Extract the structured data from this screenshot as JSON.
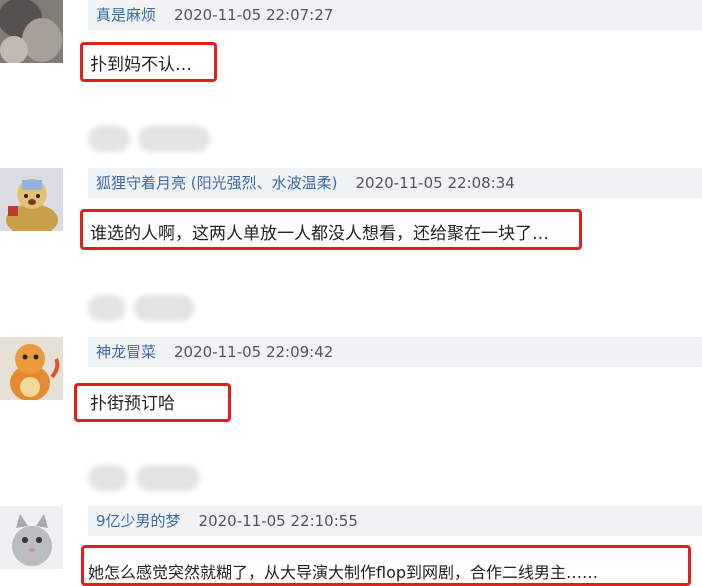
{
  "comments": [
    {
      "username": "真是麻烦",
      "note": "",
      "timestamp": "2020-11-05 22:07:27",
      "text": "扑到妈不认…",
      "avatar": "blurred-person-photo-avatar"
    },
    {
      "username": "狐狸守着月亮",
      "note": " (阳光强烈、水波温柔)",
      "timestamp": "2020-11-05 22:08:34",
      "text": "谁选的人啊，这两人单放一人都没人想看，还给聚在一块了…",
      "avatar": "cartoon-bear-avatar"
    },
    {
      "username": "神龙冒菜",
      "note": "",
      "timestamp": "2020-11-05 22:09:42",
      "text": "扑街预订哈",
      "avatar": "orange-dragon-avatar"
    },
    {
      "username": "9亿少男的梦",
      "note": "",
      "timestamp": "2020-11-05 22:10:55",
      "text": "她怎么感觉突然就糊了，从大导演大制作flop到网剧，合作二线男主……",
      "avatar": "kitten-avatar"
    }
  ],
  "colors": {
    "username": "#3d6aa3",
    "meta_background": "#eff3f6",
    "highlight_border": "#e02020"
  }
}
